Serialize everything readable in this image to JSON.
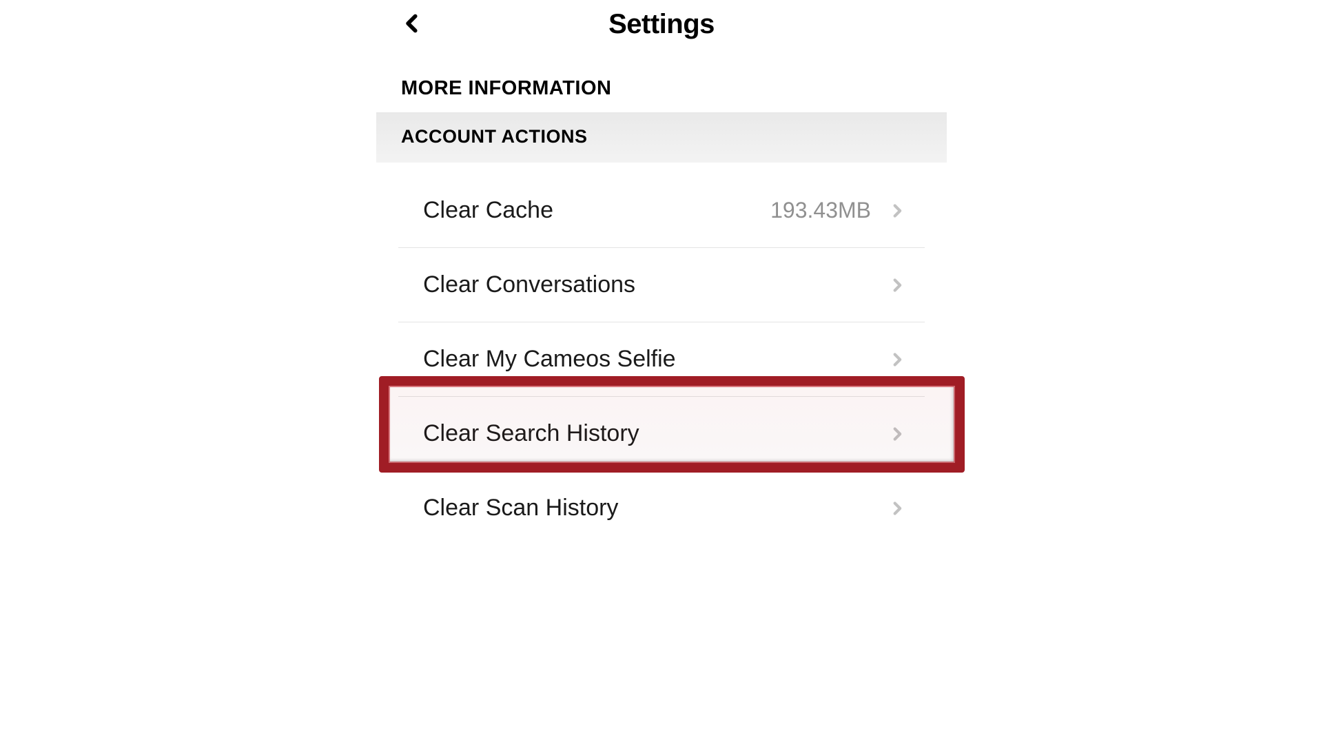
{
  "header": {
    "title": "Settings"
  },
  "sections": {
    "more_information_heading": "MORE INFORMATION",
    "account_actions_heading": "ACCOUNT ACTIONS"
  },
  "account_actions": {
    "items": [
      {
        "label": "Clear Cache",
        "value": "193.43MB"
      },
      {
        "label": "Clear Conversations",
        "value": ""
      },
      {
        "label": "Clear My Cameos Selfie",
        "value": ""
      },
      {
        "label": "Clear Search History",
        "value": ""
      },
      {
        "label": "Clear Scan History",
        "value": ""
      }
    ]
  },
  "highlight": {
    "color": "#a01d25"
  }
}
